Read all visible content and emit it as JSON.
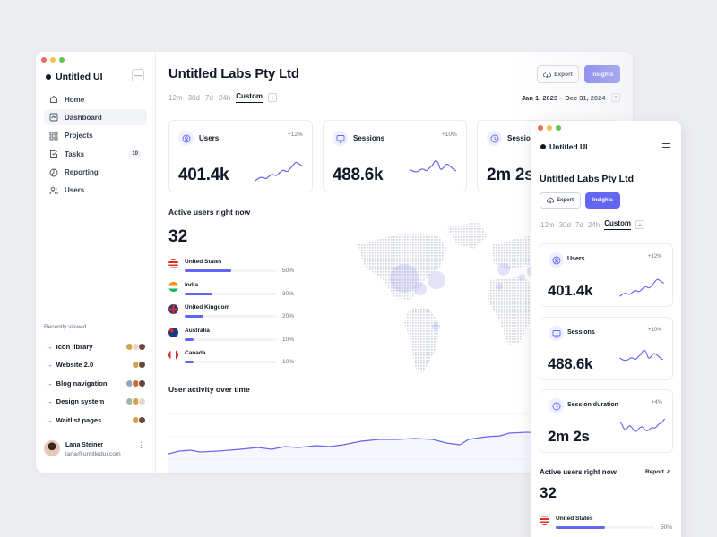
{
  "desktop": {
    "brand": "Untitled UI",
    "collapse_icon": "minus-icon",
    "nav": [
      {
        "label": "Home",
        "icon": "home-icon"
      },
      {
        "label": "Dashboard",
        "icon": "chart-icon",
        "active": true
      },
      {
        "label": "Projects",
        "icon": "grid-icon"
      },
      {
        "label": "Tasks",
        "icon": "check-square-icon",
        "badge": "10"
      },
      {
        "label": "Reporting",
        "icon": "pie-chart-icon"
      },
      {
        "label": "Users",
        "icon": "users-icon"
      }
    ],
    "recent_title": "Recently viewed",
    "recent": [
      {
        "label": "Icon library",
        "avatars": 3
      },
      {
        "label": "Website 2.0",
        "avatars": 2
      },
      {
        "label": "Blog navigation",
        "avatars": 3
      },
      {
        "label": "Design system",
        "avatars": 3
      },
      {
        "label": "Waitlist pages",
        "avatars": 2
      }
    ],
    "user": {
      "name": "Lana Steiner",
      "email": "lana@untitledui.com"
    },
    "title": "Untitled Labs Pty Ltd",
    "export_label": "Export",
    "insights_label": "Insights",
    "ranges": [
      "12m",
      "30d",
      "7d",
      "24h",
      "Custom"
    ],
    "selected_range": "Custom",
    "date_range": "Jan 1, 2023 – Dec 31, 2024",
    "metrics": [
      {
        "label": "Users",
        "value": "401.4k",
        "change": "+12%",
        "icon": "user-circle-icon"
      },
      {
        "label": "Sessions",
        "value": "488.6k",
        "change": "+10%",
        "icon": "monitor-icon"
      },
      {
        "label": "Session duration",
        "value": "2m 2s",
        "change": "+4%",
        "icon": "clock-icon"
      }
    ],
    "active_title": "Active users right now",
    "active_count": "32",
    "countries": [
      {
        "name": "United States",
        "pct": 50,
        "pct_label": "50%",
        "flag": "us-flag-icon"
      },
      {
        "name": "India",
        "pct": 30,
        "pct_label": "30%",
        "flag": "india-flag-icon"
      },
      {
        "name": "United Kingdom",
        "pct": 20,
        "pct_label": "20%",
        "flag": "uk-flag-icon"
      },
      {
        "name": "Australia",
        "pct": 10,
        "pct_label": "10%",
        "flag": "australia-flag-icon"
      },
      {
        "name": "Canada",
        "pct": 10,
        "pct_label": "10%",
        "flag": "canada-flag-icon"
      }
    ],
    "activity_title": "User activity over time"
  },
  "mobile": {
    "brand": "Untitled UI",
    "menu_icon": "hamburger-icon",
    "title": "Untitled Labs Pty Ltd",
    "export_label": "Export",
    "insights_label": "Insights",
    "ranges": [
      "12m",
      "30d",
      "7d",
      "24h",
      "Custom"
    ],
    "selected_range": "Custom",
    "active_title": "Active users right now",
    "report_label": "Report ↗",
    "active_count": "32"
  },
  "colors": {
    "accent": "#6366f1",
    "background": "#ecedf0"
  }
}
